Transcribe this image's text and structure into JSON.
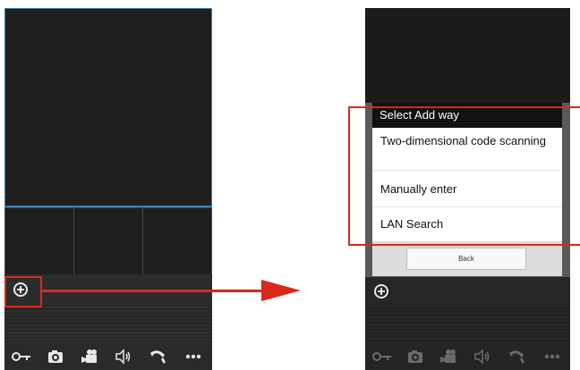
{
  "left_phone": {
    "toolbar_icons": [
      "plus-circle-icon",
      "key-icon",
      "camera-icon",
      "video-record-icon",
      "speaker-icon",
      "phone-icon",
      "more-icon"
    ]
  },
  "right_phone": {
    "dialog": {
      "title": "Select Add way",
      "items": [
        {
          "label": "Two-dimensional code scanning"
        },
        {
          "label": "Manually enter"
        },
        {
          "label": "LAN Search"
        }
      ],
      "back_label": "Back"
    }
  },
  "colors": {
    "highlight": "#d9281c",
    "accent_border": "#3e7ea8"
  }
}
